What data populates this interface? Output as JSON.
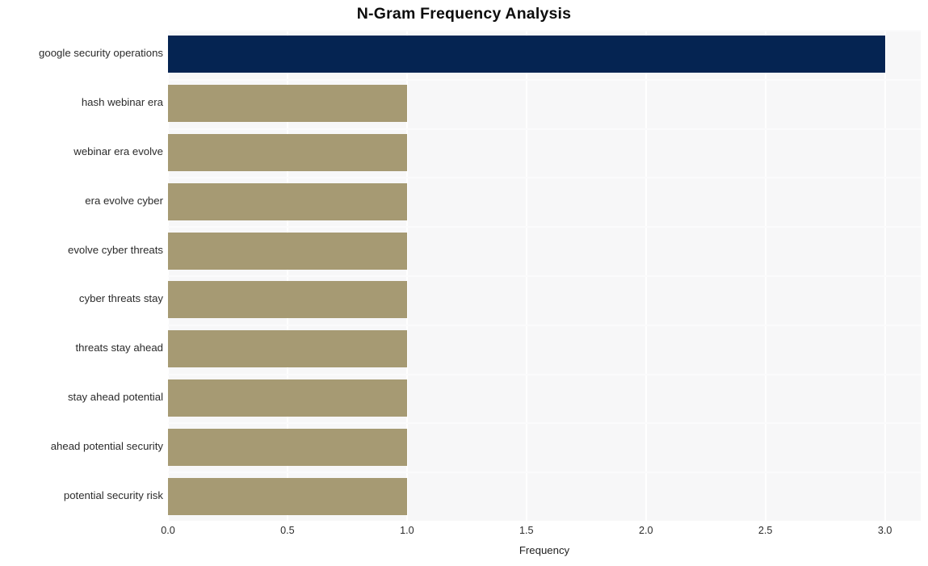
{
  "chart_data": {
    "type": "bar",
    "orientation": "horizontal",
    "title": "N-Gram Frequency Analysis",
    "xlabel": "Frequency",
    "ylabel": "",
    "xlim": [
      0,
      3.15
    ],
    "xticks": [
      "0.0",
      "0.5",
      "1.0",
      "1.5",
      "2.0",
      "2.5",
      "3.0"
    ],
    "xtick_values": [
      0.0,
      0.5,
      1.0,
      1.5,
      2.0,
      2.5,
      3.0
    ],
    "categories": [
      "google security operations",
      "hash webinar era",
      "webinar era evolve",
      "era evolve cyber",
      "evolve cyber threats",
      "cyber threats stay",
      "threats stay ahead",
      "stay ahead potential",
      "ahead potential security",
      "potential security risk"
    ],
    "values": [
      3,
      1,
      1,
      1,
      1,
      1,
      1,
      1,
      1,
      1
    ],
    "bar_colors": [
      "#052452",
      "#a69a73",
      "#a69a73",
      "#a69a73",
      "#a69a73",
      "#a69a73",
      "#a69a73",
      "#a69a73",
      "#a69a73",
      "#a69a73"
    ],
    "grid": true,
    "legend": null,
    "plot_background": "#f7f7f8",
    "gridline_color": "#ffffff",
    "highlight_color": "#052452",
    "default_bar_color": "#a69a73"
  }
}
